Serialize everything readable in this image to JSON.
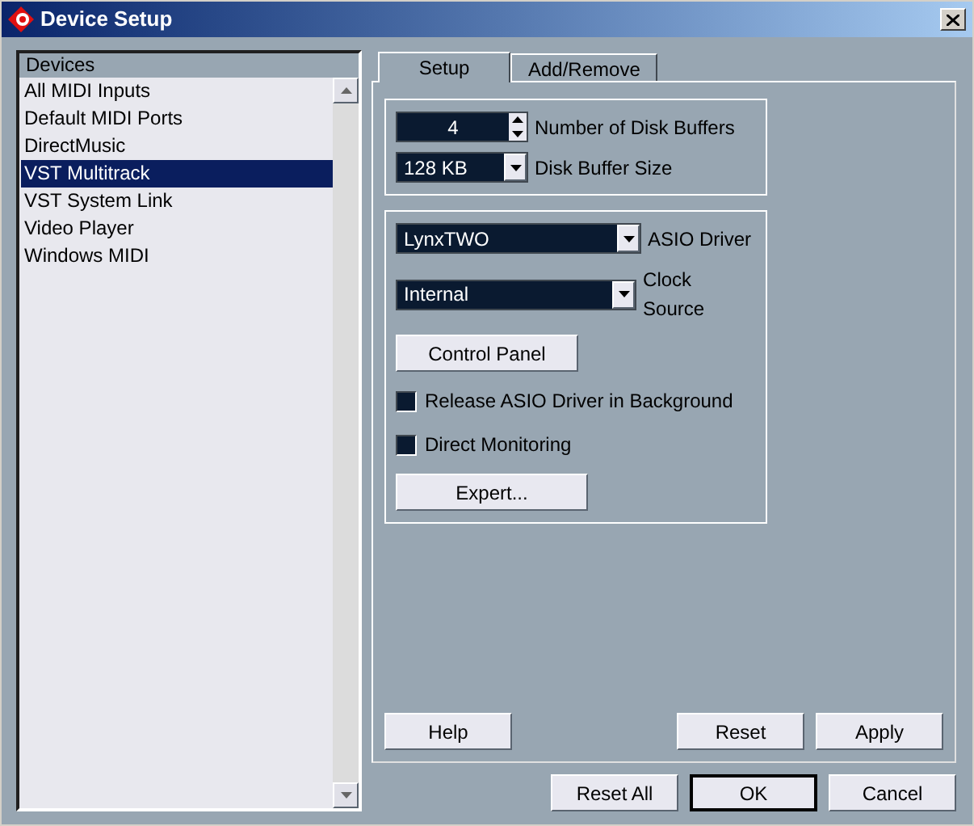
{
  "window": {
    "title": "Device Setup"
  },
  "devices": {
    "header": "Devices",
    "items": [
      {
        "label": "All MIDI Inputs",
        "selected": false
      },
      {
        "label": "Default MIDI Ports",
        "selected": false
      },
      {
        "label": "DirectMusic",
        "selected": false
      },
      {
        "label": "VST Multitrack",
        "selected": true
      },
      {
        "label": "VST System Link",
        "selected": false
      },
      {
        "label": "Video Player",
        "selected": false
      },
      {
        "label": "Windows MIDI",
        "selected": false
      }
    ]
  },
  "tabs": [
    {
      "label": "Setup",
      "selected": true
    },
    {
      "label": "Add/Remove",
      "selected": false
    }
  ],
  "disk": {
    "buffers": {
      "value": "4",
      "label": "Number of Disk Buffers"
    },
    "size": {
      "value": "128 KB",
      "label": "Disk Buffer Size"
    }
  },
  "asio": {
    "driver": {
      "value": "LynxTWO",
      "label": "ASIO Driver"
    },
    "clock": {
      "value": "Internal",
      "label": "Clock Source"
    },
    "control_panel": "Control Panel",
    "options": [
      {
        "label": "Release ASIO Driver in Background",
        "checked": false
      },
      {
        "label": "Direct Monitoring",
        "checked": false
      }
    ],
    "expert": "Expert..."
  },
  "panel_buttons": {
    "help": "Help",
    "reset": "Reset",
    "apply": "Apply"
  },
  "dialog_buttons": [
    {
      "label": "Reset All",
      "default": false
    },
    {
      "label": "OK",
      "default": true
    },
    {
      "label": "Cancel",
      "default": false
    }
  ]
}
